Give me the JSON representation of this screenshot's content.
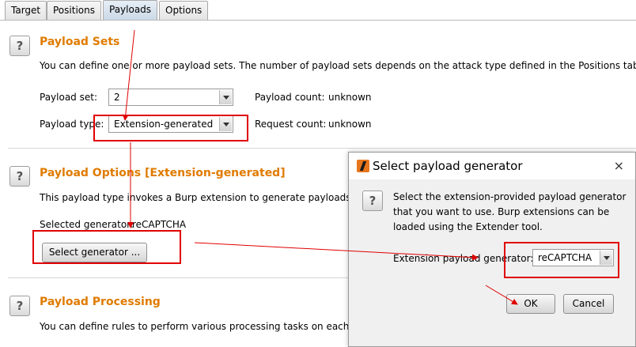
{
  "tabs": [
    {
      "label": "Target"
    },
    {
      "label": "Positions"
    },
    {
      "label": "Payloads"
    },
    {
      "label": "Options"
    }
  ],
  "payload_sets": {
    "title": "Payload Sets",
    "description": "You can define one or more payload sets. The number of payload sets depends on the attack type defined in the Positions tab. Va",
    "set_label": "Payload set:",
    "set_value": "2",
    "count_label": "Payload count:",
    "count_value": "unknown",
    "type_label": "Payload type:",
    "type_value": "Extension-generated",
    "request_label": "Request count:",
    "request_value": "unknown"
  },
  "payload_options": {
    "title": "Payload Options [Extension-generated]",
    "description": "This payload type invokes a Burp extension to generate payloads.",
    "selected_label": "Selected generator:",
    "selected_value": "reCAPTCHA",
    "select_button": "Select generator ..."
  },
  "payload_processing": {
    "title": "Payload Processing",
    "description": "You can define rules to perform various processing tasks on each pa"
  },
  "dialog": {
    "title": "Select payload generator",
    "close": "×",
    "message_line1": "Select the extension-provided payload generator",
    "message_line2": "that you want to use. Burp extensions can be",
    "message_line3": "loaded using the Extender tool.",
    "field_label": "Extension payload generator:",
    "field_value": "reCAPTCHA",
    "ok_label": "OK",
    "cancel_label": "Cancel"
  },
  "help_glyph": "?",
  "colors": {
    "section_title": "#e07b00",
    "highlight": "#e00000",
    "active_tab": "#c9d7e6"
  }
}
